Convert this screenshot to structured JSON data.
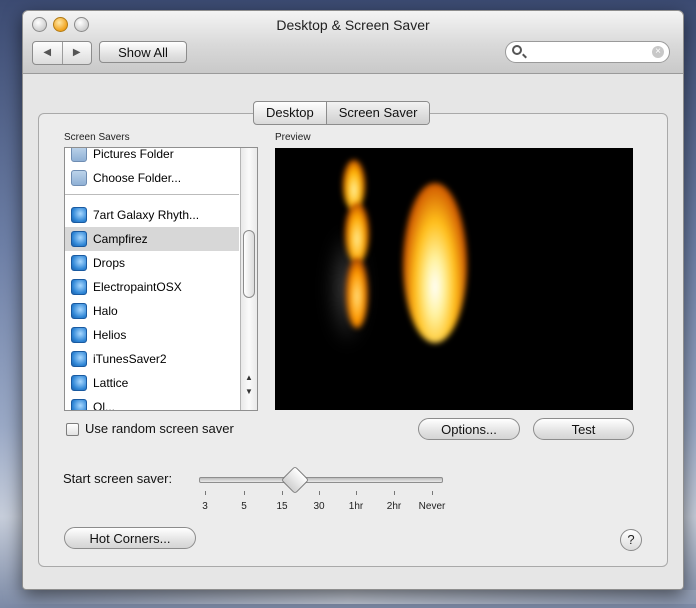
{
  "window": {
    "title": "Desktop & Screen Saver"
  },
  "toolbar": {
    "back_label": "◀",
    "forward_label": "▶",
    "show_all_label": "Show All",
    "search_placeholder": ""
  },
  "tabs": [
    {
      "label": "Desktop",
      "active": false
    },
    {
      "label": "Screen Saver",
      "active": true
    }
  ],
  "screen_savers": {
    "heading": "Screen Savers",
    "items": [
      {
        "label": "Pictures Folder",
        "icon": "folder-icon"
      },
      {
        "label": "Choose Folder...",
        "icon": "folder-icon"
      },
      {
        "label": "7art Galaxy Rhyth...",
        "icon": "screensaver-icon"
      },
      {
        "label": "Campfirez",
        "icon": "screensaver-icon",
        "selected": true
      },
      {
        "label": "Drops",
        "icon": "screensaver-icon"
      },
      {
        "label": "ElectropaintOSX",
        "icon": "screensaver-icon"
      },
      {
        "label": "Halo",
        "icon": "screensaver-icon"
      },
      {
        "label": "Helios",
        "icon": "screensaver-icon"
      },
      {
        "label": "iTunesSaver2",
        "icon": "screensaver-icon"
      },
      {
        "label": "Lattice",
        "icon": "screensaver-icon"
      },
      {
        "label": "Ol...",
        "icon": "screensaver-icon"
      }
    ]
  },
  "preview": {
    "heading": "Preview"
  },
  "random": {
    "label": "Use random screen saver",
    "checked": false
  },
  "buttons": {
    "options": "Options...",
    "test": "Test",
    "hot_corners": "Hot Corners...",
    "help": "?"
  },
  "slider": {
    "label": "Start screen saver:",
    "ticks": [
      "3",
      "5",
      "15",
      "30",
      "1hr",
      "2hr",
      "Never"
    ],
    "value_index_fraction": 0.38
  }
}
